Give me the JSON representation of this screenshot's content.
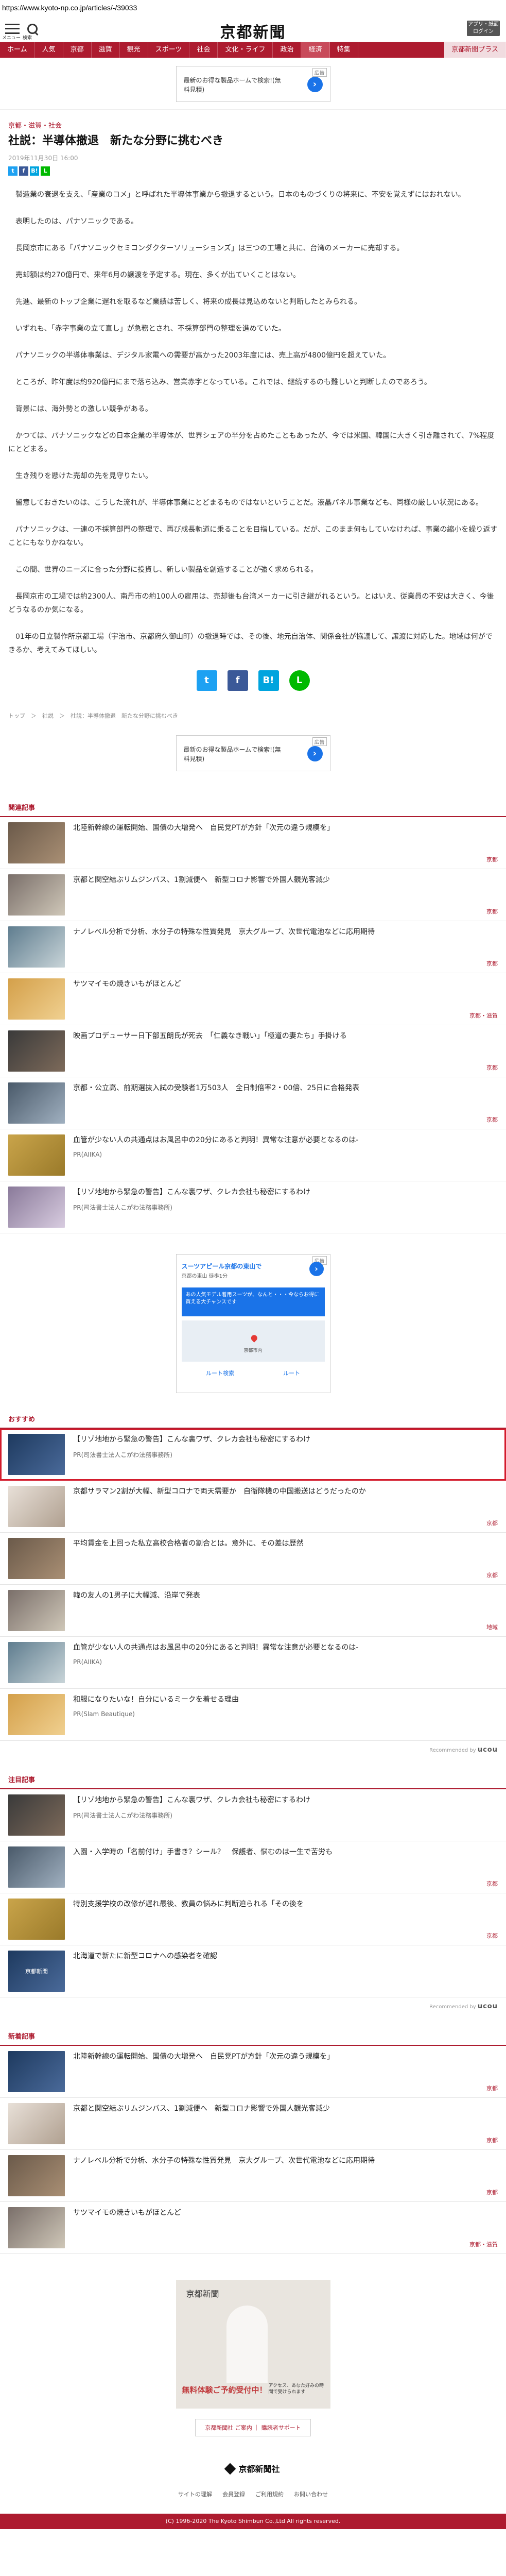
{
  "url": "https://www.kyoto-np.co.jp/articles/-/39033",
  "header": {
    "logo": "京都新聞",
    "menu_label": "メニュー",
    "search_label": "検索",
    "app_button": "アプリ・紙面ログイン"
  },
  "nav": {
    "items": [
      "ホーム",
      "人気",
      "京都",
      "滋賀",
      "観光",
      "スポーツ",
      "社会",
      "文化・ライフ",
      "政治",
      "経済",
      "特集",
      "京都新聞プラス"
    ]
  },
  "ad": {
    "tag": "広告",
    "text": "最新のお得な製品ホームで検索!(無料見積)",
    "arrow": "›"
  },
  "article": {
    "category": "京都・滋賀・社会",
    "title": "社説：半導体撤退　新たな分野に挑むべき",
    "date": "2019年11月30日 16:00",
    "share_small": [
      "t",
      "f",
      "B!",
      "L"
    ],
    "paragraphs": [
      "製造業の衰退を支え、「産業のコメ」と呼ばれた半導体事業から撤退するという。日本のものづくりの将来に、不安を覚えずにはおれない。",
      "表明したのは、パナソニックである。",
      "長岡京市にある「パナソニックセミコンダクターソリューションズ」は三つの工場と共に、台湾のメーカーに売却する。",
      "売却額は約270億円で、来年6月の譲渡を予定する。現在、多くが出ていくことはない。",
      "先進、最新のトップ企業に遅れを取るなど業績は苦しく、将来の成長は見込めないと判断したとみられる。",
      "いずれも、「赤字事業の立て直し」が急務とされ、不採算部門の整理を進めていた。",
      "パナソニックの半導体事業は、デジタル家電への需要が高かった2003年度には、売上高が4800億円を超えていた。",
      "ところが、昨年度は約920億円にまで落ち込み、営業赤字となっている。これでは、継続するのも難しいと判断したのであろう。",
      "背景には、海外勢との激しい競争がある。",
      "かつては、パナソニックなどの日本企業の半導体が、世界シェアの半分を占めたこともあったが、今では米国、韓国に大きく引き離されて、7%程度にとどまる。",
      "生き残りを懸けた売却の先を見守りたい。",
      "留意しておきたいのは、こうした流れが、半導体事業にとどまるものではないということだ。液晶パネル事業なども、同様の厳しい状況にある。",
      "パナソニックは、一連の不採算部門の整理で、再び成長軌道に乗ることを目指している。だが、このまま何もしていなければ、事業の縮小を繰り返すことにもなりかねない。",
      "この間、世界のニーズに合った分野に投資し、新しい製品を創造することが強く求められる。",
      "長岡京市の工場では約2300人、南丹市の約100人の雇用は、売却後も台湾メーカーに引き継がれるという。とはいえ、従業員の不安は大きく、今後どうなるのか気になる。",
      "01年の日立製作所京都工場（宇治市、京都府久御山町）の撤退時では、その後、地元自治体、関係会社が協議して、譲渡に対応した。地域は何ができるか、考えてみてほしい。"
    ],
    "share_big": [
      "t",
      "f",
      "B!",
      "L"
    ]
  },
  "breadcrumb": "トップ　＞　社説　＞　社説：半導体撤退　新たな分野に挑むべき",
  "sections": {
    "related": {
      "title": "関連記事",
      "items": [
        {
          "title": "北陸新幹線の運転開始、国債の大増発へ　自民党PTが方針「次元の違う規模を」",
          "cat": "京都"
        },
        {
          "title": "京都と関空結ぶリムジンバス、1割減便へ　新型コロナ影響で外国人観光客減少",
          "cat": "京都"
        },
        {
          "title": "ナノレベル分析で分析、水分子の特殊な性質発見　京大グループ、次世代電池などに応用期待",
          "cat": "京都"
        },
        {
          "title": "サツマイモの焼きいもがほとんど",
          "cat": "京都・滋賀"
        },
        {
          "title": "映画プロデューサー日下部五朗氏が死去　「仁義なき戦い」「極道の妻たち」手掛ける",
          "cat": "京都"
        },
        {
          "title": "京都・公立高、前期選抜入試の受験者1万503人　全日制倍率2・00倍、25日に合格発表",
          "cat": "京都"
        },
        {
          "title": "血管が少ない人の共通点はお風呂中の20分にあると判明！異常な注意が必要となるのは-",
          "pr": "PR(AIIKA)"
        },
        {
          "title": "【リゾ地地から緊急の警告】こんな裏ワザ、クレカ会社も秘密にするわけ",
          "pr": "PR(司法書士法人こがわ法務事務所)"
        }
      ]
    },
    "map_ad": {
      "tag": "広告",
      "title": "スーツアピール京都の東山で",
      "subtitle": "京都の東山 徒歩1分",
      "banner": "あの人気モデル着用スーツが、なんと・・・今ならお得に買える大チャンスです",
      "map_label": "京都市内",
      "action1": "ルート検索",
      "action2": "ルート",
      "arrow": "›"
    },
    "recommend": {
      "title": "おすすめ",
      "items": [
        {
          "title": "【リゾ地地から緊急の警告】こんな裏ワザ、クレカ会社も秘密にするわけ",
          "pr": "PR(司法書士法人こがわ法務事務所)",
          "highlight": true
        },
        {
          "title": "京都サラマン2割が大幅、新型コロナで両天需要か　自衛隊機の中国搬送はどうだったのか",
          "cat": "京都"
        },
        {
          "title": "平均賃金を上回った私立高校合格者の割合とは。意外に、その差は歴然",
          "cat": "京都"
        },
        {
          "title": "韓の友人の1男子に大幅減、沿岸で発表",
          "cat": "地域"
        },
        {
          "title": "血管が少ない人の共通点はお風呂中の20分にあると判明！異常な注意が必要となるのは-",
          "pr": "PR(AIIKA)"
        },
        {
          "title": "和服になりたいな！自分にいるミークを着せる理由",
          "pr": "PR(Slam Beautique)"
        }
      ],
      "powered": "Recommended by",
      "brand": "ucou"
    },
    "attention": {
      "title": "注目記事",
      "items": [
        {
          "title": "【リゾ地地から緊急の警告】こんな裏ワザ、クレカ会社も秘密にするわけ",
          "pr": "PR(司法書士法人こがわ法務事務所)"
        },
        {
          "title": "入園・入学時の「名前付け」手書き？シール？　保護者、悩むのは一生で苦労も",
          "cat": "京都"
        },
        {
          "title": "特別支援学校の改修が遅れ最後、教員の悩みに判断迫られる「その後を",
          "cat": "京都"
        },
        {
          "title": "北海道で新たに新型コロナへの感染者を確認",
          "cat": "",
          "badge": "京都新聞"
        }
      ],
      "powered": "Recommended by",
      "brand": "ucou"
    },
    "latest": {
      "title": "新着記事",
      "items": [
        {
          "title": "北陸新幹線の運転開始、国債の大増発へ　自民党PTが方針「次元の違う規模を」",
          "cat": "京都"
        },
        {
          "title": "京都と関空結ぶリムジンバス、1割減便へ　新型コロナ影響で外国人観光客減少",
          "cat": "京都"
        },
        {
          "title": "ナノレベル分析で分析、水分子の特殊な性質発見　京大グループ、次世代電池などに応用期待",
          "cat": "京都"
        },
        {
          "title": "サツマイモの焼きいもがほとんど",
          "cat": "京都・滋賀"
        }
      ]
    }
  },
  "bottom_ad": {
    "logo": "京都新聞",
    "text": "無料体験ご予約受付中！",
    "text2": "アクセス、あなた好みの時間で受けられます"
  },
  "footer": {
    "links": "京都新聞社 ご案内 ｜ 購読者サポート",
    "logo": "京都新聞社",
    "nav": [
      "サイトの理解",
      "会員登録",
      "ご利用規約",
      "お問い合わせ"
    ],
    "copyright": "(C) 1996-2020 The Kyoto Shimbun Co.,Ltd All rights reserved."
  }
}
